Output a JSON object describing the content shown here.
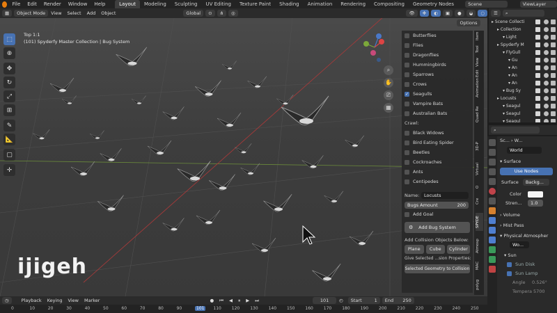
{
  "menubar": {
    "menus": [
      "File",
      "Edit",
      "Render",
      "Window",
      "Help"
    ],
    "workspaces": [
      "Layout",
      "Modeling",
      "Sculpting",
      "UV Editing",
      "Texture Paint",
      "Shading",
      "Animation",
      "Rendering",
      "Compositing",
      "Geometry Nodes"
    ],
    "active_workspace": "Layout",
    "scene": "Scene",
    "view_layer": "ViewLayer"
  },
  "viewport_header": {
    "mode": "Object Mode",
    "menus": [
      "View",
      "Select",
      "Add",
      "Object"
    ],
    "orientation": "Global",
    "options": "Options"
  },
  "viewport": {
    "info_line1": "Top 1:1",
    "info_line2": "(101) Spyderfy Master Collection | Bug System",
    "watermark": "ijigeh"
  },
  "npanel": {
    "fly_items": [
      {
        "label": "Butterflies",
        "checked": false
      },
      {
        "label": "Flies",
        "checked": false
      },
      {
        "label": "Dragonflies",
        "checked": false
      },
      {
        "label": "Hummingbirds",
        "checked": false
      },
      {
        "label": "Sparrows",
        "checked": false
      },
      {
        "label": "Crows",
        "checked": false
      },
      {
        "label": "Seagulls",
        "checked": true
      },
      {
        "label": "Vampire Bats",
        "checked": false
      },
      {
        "label": "Australian Bats",
        "checked": false
      }
    ],
    "crawl_label": "Crawl:",
    "crawl_items": [
      {
        "label": "Black Widows",
        "checked": false
      },
      {
        "label": "Bird Eating Spider",
        "checked": false
      },
      {
        "label": "Beetles",
        "checked": false
      },
      {
        "label": "Cockroaches",
        "checked": false
      },
      {
        "label": "Ants",
        "checked": false
      },
      {
        "label": "Centipedes",
        "checked": false
      }
    ],
    "name_label": "Name:",
    "name_value": "Locusts",
    "bugs_amount_label": "Bugs Amount",
    "bugs_amount_value": "200",
    "add_goal": "Add Goal",
    "add_bug_system": "Add Bug System",
    "collision_label": "Add Collision Objects Below:",
    "collision_buttons": [
      "Plane",
      "Cube",
      "Cylinder"
    ],
    "give_selected": "Give Selected ...sion Properties:",
    "selected_geo_btn": "Selected Geometry to Collision"
  },
  "vertical_tabs": [
    "Item",
    "Tool",
    "View",
    "Edit",
    "Animation",
    "Quad Re",
    "3D-P",
    "Virtual",
    "O",
    "Cre",
    "SPYDE",
    "Atmosp",
    "MAC",
    "polyg"
  ],
  "outliner": {
    "search_placeholder": "",
    "rows": [
      {
        "label": "Scene Collecti",
        "indent": 0
      },
      {
        "label": "Collection",
        "indent": 1
      },
      {
        "label": "Light",
        "indent": 2
      },
      {
        "label": "Spyderfy M",
        "indent": 1
      },
      {
        "label": "FlyGull",
        "indent": 2
      },
      {
        "label": "Gu",
        "indent": 3
      },
      {
        "label": "An",
        "indent": 3
      },
      {
        "label": "An",
        "indent": 3
      },
      {
        "label": "An",
        "indent": 3
      },
      {
        "label": "Bug Sy",
        "indent": 2
      },
      {
        "label": "Locusts",
        "indent": 1
      },
      {
        "label": "Seagul",
        "indent": 2
      },
      {
        "label": "Seagul",
        "indent": 2
      },
      {
        "label": "Seagul",
        "indent": 2
      }
    ]
  },
  "properties": {
    "breadcrumb_1": "Sc...",
    "breadcrumb_2": "W...",
    "world_name": "World",
    "surface_panel": "Surface",
    "use_nodes": "Use Nodes",
    "surface_label": "Surface",
    "surface_value": "Backg...",
    "color_label": "Color",
    "strength_label": "Stren...",
    "strength_value": "1.0",
    "volume_panel": "Volume",
    "mist_panel": "Mist Pass",
    "atmosphere_panel": "Physical Atmospher",
    "world_field": "Wo...",
    "sun_panel": "Sun",
    "sun_disk": "Sun Disk",
    "sun_lamp": "Sun Lamp",
    "angle_label": "Angle",
    "angle_value": "0.526°",
    "temp_label": "Tempera",
    "temp_value": "5700"
  },
  "timeline": {
    "menus": [
      "Playback",
      "Keying",
      "View",
      "Marker"
    ],
    "current_frame": "101",
    "start_label": "Start",
    "start_value": "1",
    "end_label": "End",
    "end_value": "250",
    "ticks": [
      "0",
      "10",
      "20",
      "30",
      "40",
      "50",
      "60",
      "70",
      "80",
      "90",
      "101",
      "110",
      "120",
      "130",
      "140",
      "150",
      "160",
      "170",
      "180",
      "190",
      "200",
      "210",
      "220",
      "230",
      "240",
      "250"
    ]
  }
}
